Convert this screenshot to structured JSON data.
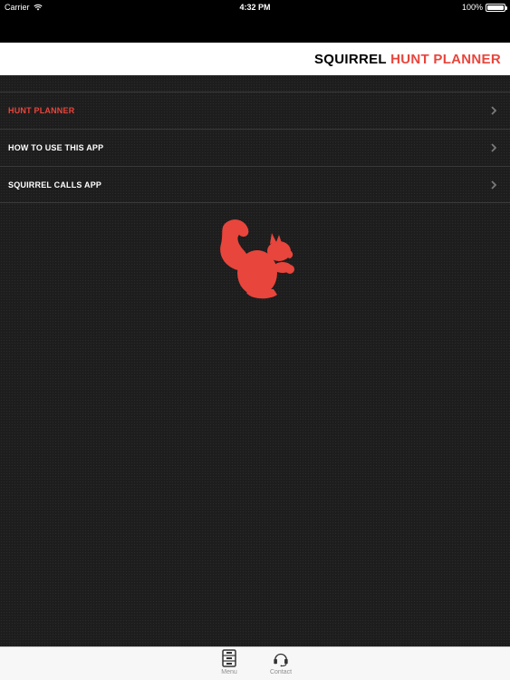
{
  "status_bar": {
    "carrier": "Carrier",
    "time": "4:32 PM",
    "battery": "100%",
    "battery_level": 1.0
  },
  "header": {
    "title_part1": "SQUIRREL",
    "title_part2": "HUNT PLANNER"
  },
  "menu": {
    "items": [
      {
        "label": "HUNT PLANNER",
        "active": true
      },
      {
        "label": "HOW TO USE THIS APP",
        "active": false
      },
      {
        "label": "SQUIRREL CALLS APP",
        "active": false
      }
    ]
  },
  "colors": {
    "accent": "#e8453c",
    "background": "#1d1d1d",
    "header_bg": "#ffffff"
  },
  "icons": {
    "logo": "squirrel-silhouette",
    "chevron": "chevron-right-icon",
    "tab_menu": "cabinet-icon",
    "tab_contact": "headset-icon"
  },
  "tabs": [
    {
      "label": "Menu",
      "selected": true
    },
    {
      "label": "Contact",
      "selected": false
    }
  ]
}
